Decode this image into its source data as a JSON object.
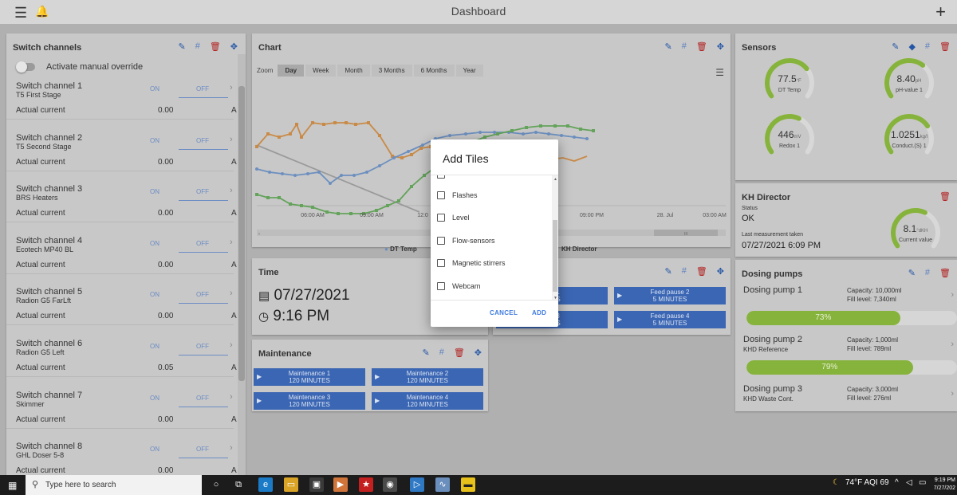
{
  "topbar": {
    "title": "Dashboard",
    "menu_icon": "☰",
    "bell_icon": "🔔",
    "plus_icon": "+"
  },
  "icons": {
    "edit": "✎",
    "hash": "#",
    "delete": "🗑",
    "move": "✥",
    "chevron": "›",
    "droplet": "◆"
  },
  "switch_panel": {
    "title": "Switch channels",
    "override_label": "Activate manual override",
    "on_label": "ON",
    "off_label": "OFF",
    "current_label": "Actual current",
    "unit": "A",
    "channels": [
      {
        "name": "Switch channel 1",
        "sub": "T5 First Stage",
        "current": "0.00"
      },
      {
        "name": "Switch channel 2",
        "sub": "T5 Second Stage",
        "current": "0.00"
      },
      {
        "name": "Switch channel 3",
        "sub": "BRS Heaters",
        "current": "0.00"
      },
      {
        "name": "Switch channel 4",
        "sub": "Ecotech MP40 BL",
        "current": "0.00"
      },
      {
        "name": "Switch channel 5",
        "sub": "Radion G5 FarLft",
        "current": "0.00"
      },
      {
        "name": "Switch channel 6",
        "sub": "Radion G5 Left",
        "current": "0.05"
      },
      {
        "name": "Switch channel 7",
        "sub": "Skimmer",
        "current": "0.00"
      },
      {
        "name": "Switch channel 8",
        "sub": "GHL Doser 5-8",
        "current": "0.00"
      }
    ]
  },
  "chart": {
    "title": "Chart",
    "zoom_label": "Zoom",
    "zoom_options": [
      "Day",
      "Week",
      "Month",
      "3 Months",
      "6 Months",
      "Year"
    ],
    "zoom_active": "Day",
    "menu_icon": "☰",
    "x_ticks": [
      "06:00 AM",
      "09:00 AM",
      "12:0",
      "09:00 PM",
      "28. Jul",
      "03:00 AM"
    ],
    "legend": [
      "DT Temp",
      "KH Director"
    ],
    "colors": {
      "orange": "#c98a47",
      "blue": "#6c8fbf",
      "green": "#63a35a",
      "gray": "#9a9a9a"
    },
    "nav_label": "III"
  },
  "sensors": {
    "title": "Sensors",
    "gauges": [
      {
        "value": "77.5",
        "unit": "°F",
        "label": "DT Temp",
        "level": 0.7
      },
      {
        "value": "8.40",
        "unit": "pH",
        "label": "pH-value 1",
        "level": 0.65
      },
      {
        "value": "446",
        "unit": "mV",
        "label": "Redox 1",
        "level": 0.6
      },
      {
        "value": "1.0251",
        "unit": "kg/l",
        "label": "Conduct.(S) 1",
        "level": 0.72
      }
    ]
  },
  "kh": {
    "title": "KH Director",
    "status_label": "Status",
    "status": "OK",
    "last_label": "Last measurement taken",
    "last_value": "07/27/2021 6:09 PM",
    "gauge_value": "8.1",
    "gauge_unit": "°dKH",
    "gauge_label": "Current value",
    "level": 0.6
  },
  "time": {
    "title": "Time",
    "date": "07/27/2021",
    "time": "9:16 PM",
    "cal_icon": "📅",
    "clock_icon": "🕘"
  },
  "maintenance": {
    "title": "Maintenance",
    "buttons": [
      {
        "label": "Maintenance 1",
        "duration": "120 MINUTES"
      },
      {
        "label": "Maintenance 2",
        "duration": "120 MINUTES"
      },
      {
        "label": "Maintenance 3",
        "duration": "120 MINUTES"
      },
      {
        "label": "Maintenance 4",
        "duration": "120 MINUTES"
      }
    ]
  },
  "feed": {
    "buttons": [
      {
        "label": "use 1",
        "duration": "UTES"
      },
      {
        "label": "Feed pause 2",
        "duration": "5 MINUTES"
      },
      {
        "label": "use 3",
        "duration": "UTES"
      },
      {
        "label": "Feed pause 4",
        "duration": "5 MINUTES"
      }
    ]
  },
  "dosing": {
    "title": "Dosing pumps",
    "pumps": [
      {
        "name": "Dosing pump 1",
        "sub": "",
        "capacity": "Capacity: 10,000ml",
        "fill": "Fill level: 7,340ml",
        "percent": "73%",
        "level": 0.73
      },
      {
        "name": "Dosing pump 2",
        "sub": "KHD Reference",
        "capacity": "Capacity: 1,000ml",
        "fill": "Fill level: 789ml",
        "percent": "79%",
        "level": 0.79
      },
      {
        "name": "Dosing pump 3",
        "sub": "KHD Waste Cont.",
        "capacity": "Capacity: 3,000ml",
        "fill": "Fill level: 276ml",
        "percent": "",
        "level": 0
      }
    ]
  },
  "dialog": {
    "title": "Add Tiles",
    "options": [
      "Flashes",
      "Level",
      "Flow-sensors",
      "Magnetic stirrers",
      "Webcam"
    ],
    "cancel": "CANCEL",
    "add": "ADD"
  },
  "taskbar": {
    "search_placeholder": "Type here to search",
    "weather": "74°F AQI 69",
    "clock_time": "9:19 PM",
    "clock_date": "7/27/202"
  }
}
